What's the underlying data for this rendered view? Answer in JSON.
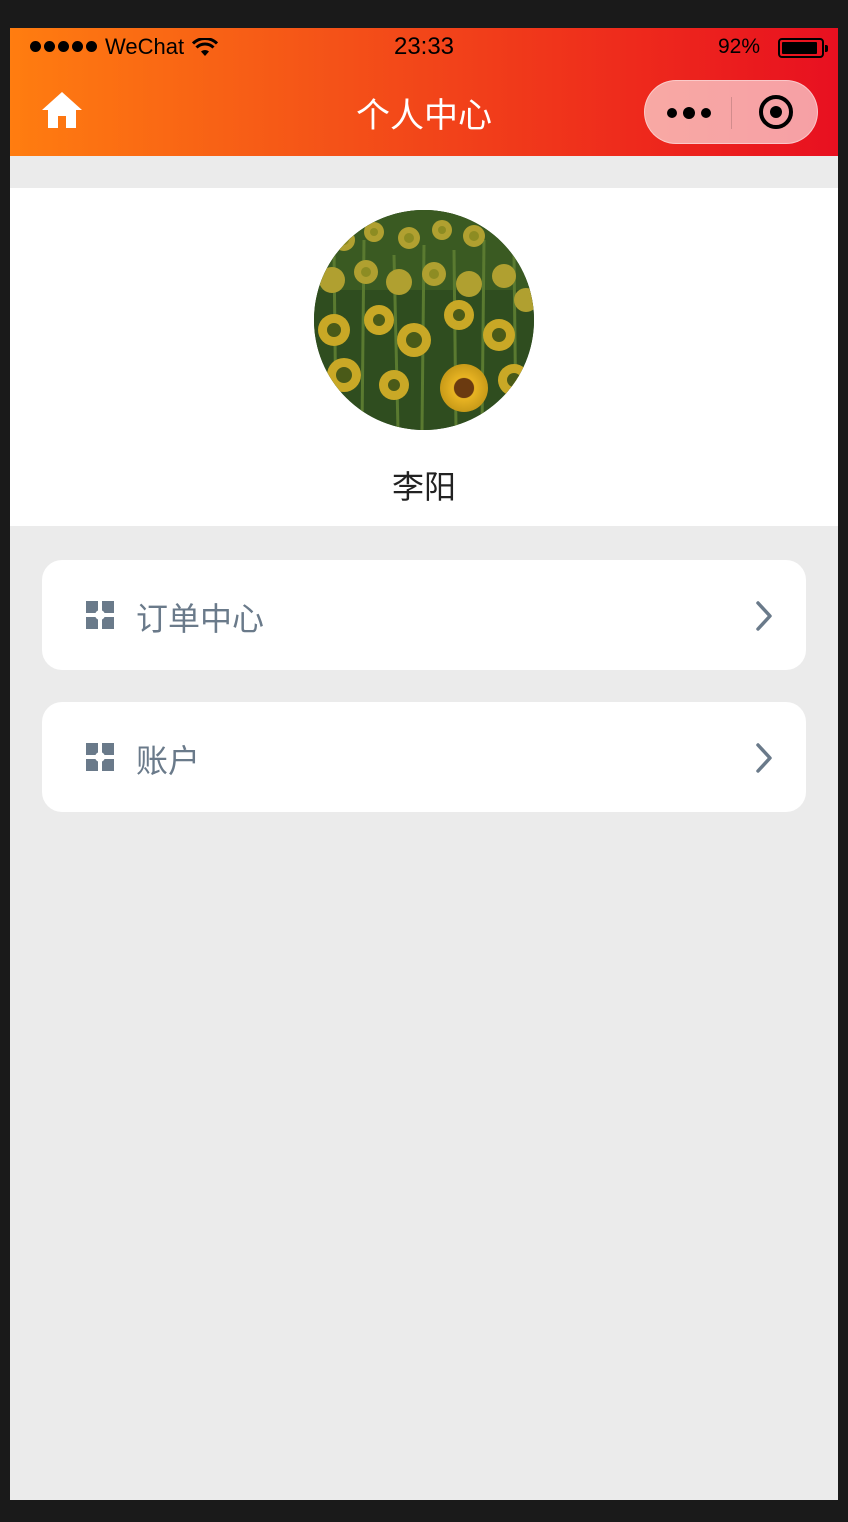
{
  "status_bar": {
    "carrier": "WeChat",
    "time": "23:33",
    "battery_percent_text": "92%",
    "battery_level": 0.92,
    "signal_dots": 5
  },
  "nav": {
    "title": "个人中心",
    "home_icon": "home-icon",
    "more_icon": "more-dots-icon",
    "close_icon": "target-close-icon"
  },
  "profile": {
    "username": "李阳",
    "avatar": "sunflower-field-avatar"
  },
  "menu": [
    {
      "label": "订单中心",
      "icon": "grid-icon",
      "arrow_icon": "chevron-right-icon"
    },
    {
      "label": "账户",
      "icon": "grid-icon",
      "arrow_icon": "chevron-right-icon"
    }
  ],
  "colors": {
    "header_gradient_start": "#ff7d10",
    "header_gradient_end": "#e81020",
    "page_background": "#ebebeb",
    "card_background": "#ffffff",
    "menu_text": "#6a7a8a"
  }
}
